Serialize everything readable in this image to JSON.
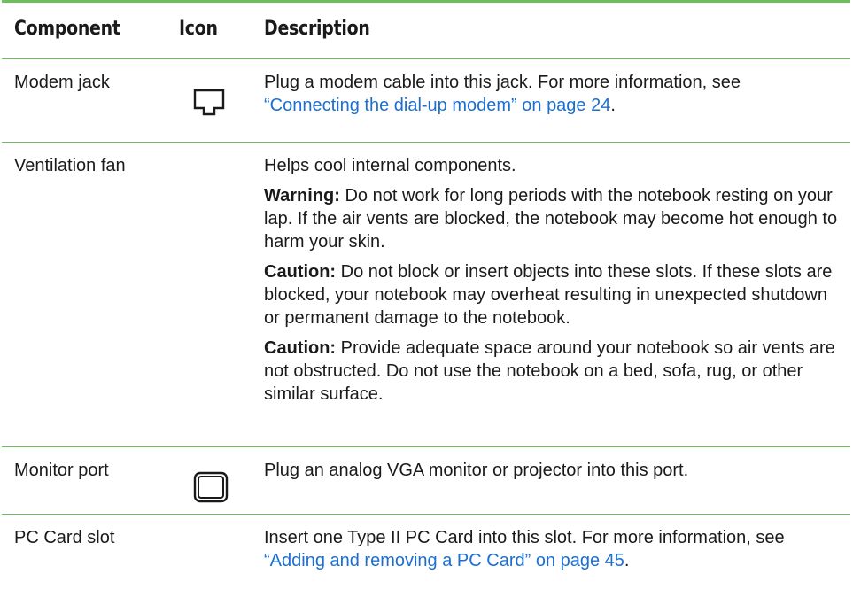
{
  "header": {
    "component": "Component",
    "icon": "Icon",
    "description": "Description"
  },
  "rows": [
    {
      "component": "Modem jack",
      "icon": "modem-jack-icon",
      "paragraphs": [
        {
          "text": "Plug a modem cable into this jack. For more information, see ",
          "link": "“Connecting the dial-up modem” on page 24",
          "after": "."
        }
      ]
    },
    {
      "component": "Ventilation fan",
      "icon": "",
      "paragraphs": [
        {
          "text": "Helps cool internal components."
        },
        {
          "label": "Warning:",
          "text": " Do not work for long periods with the notebook resting on your lap. If the air vents are blocked, the notebook may become hot enough to harm your skin."
        },
        {
          "label": "Caution:",
          "text": " Do not block or insert objects into these slots. If these slots are blocked, your notebook may overheat resulting in unexpected shutdown or permanent damage to the notebook."
        },
        {
          "label": "Caution:",
          "text": " Provide adequate space around your notebook so air vents are not obstructed. Do not use the notebook on a bed, sofa, rug, or other similar surface."
        }
      ]
    },
    {
      "component": "Monitor port",
      "icon": "monitor-port-icon",
      "paragraphs": [
        {
          "text": "Plug an analog VGA monitor or projector into this port."
        }
      ]
    },
    {
      "component": "PC Card slot",
      "icon": "",
      "paragraphs": [
        {
          "text": "Insert one Type II PC Card into this slot. For more information, see ",
          "link": "“Adding and removing a PC Card” on page 45",
          "after": "."
        }
      ]
    }
  ],
  "colors": {
    "rule": "#6cc05a",
    "link": "#1c6fd1",
    "text": "#1a1a1a"
  }
}
